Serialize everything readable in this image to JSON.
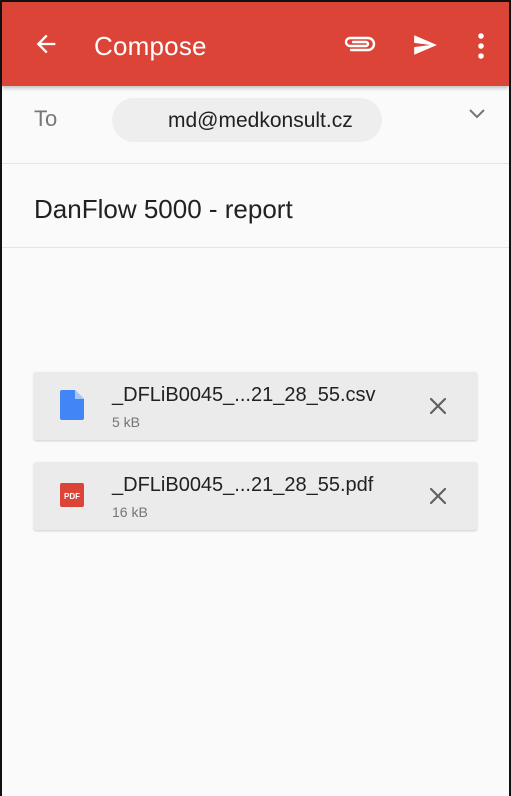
{
  "appbar": {
    "title": "Compose",
    "back_icon": "arrow-back-icon",
    "attach_icon": "paperclip-icon",
    "send_icon": "send-icon",
    "more_icon": "more-vert-icon",
    "color": "#db4437"
  },
  "recipient": {
    "label": "To",
    "email": "md@medkonsult.cz",
    "expand_icon": "chevron-down-icon"
  },
  "subject": "DanFlow 5000 - report",
  "attachments": [
    {
      "name": "_DFLiB0045_...21_28_55.csv",
      "size": "5 kB",
      "icon": "document-icon",
      "icon_color": "#4285f4"
    },
    {
      "name": "_DFLiB0045_...21_28_55.pdf",
      "size": "16 kB",
      "icon": "pdf-icon",
      "icon_color": "#db4437"
    }
  ]
}
